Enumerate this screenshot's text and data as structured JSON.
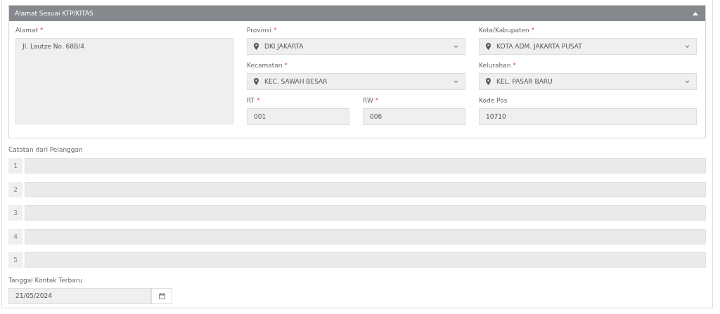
{
  "panel": {
    "title": "Alamat Sesuai KTP/KITAS",
    "expanded": true,
    "fields": [
      {
        "kind": "textarea",
        "label": "Alamat",
        "required_mark": "*",
        "value": "Jl. Lautze No. 68B/4"
      },
      {
        "kind": "select",
        "label": "Provinsi",
        "required_mark": "*",
        "value": "DKI JAKARTA"
      },
      {
        "kind": "select",
        "label": "Kota/Kabupaten",
        "required_mark": "*",
        "value": "KOTA ADM. JAKARTA PUSAT"
      },
      {
        "kind": "select",
        "label": "Kecamatan",
        "required_mark": "*",
        "value": "KEC. SAWAH BESAR"
      },
      {
        "kind": "select",
        "label": "Kelurahan",
        "required_mark": "*",
        "value": "KEL. PASAR BARU"
      },
      {
        "kind": "text",
        "label": "RT",
        "required_mark": "*",
        "value": "001"
      },
      {
        "kind": "text",
        "label": "RW",
        "required_mark": "*",
        "value": "006"
      },
      {
        "kind": "text",
        "label": "Kode Pos",
        "value": "10710"
      }
    ]
  },
  "notes": {
    "label": "Catatan dari Pelanggan",
    "rows": [
      {
        "number": "1"
      },
      {
        "number": "2"
      },
      {
        "number": "3"
      },
      {
        "number": "4"
      },
      {
        "number": "5"
      }
    ]
  },
  "last_contact": {
    "label": "Tanggal Kontak Terbaru",
    "value": "21/05/2024"
  }
}
